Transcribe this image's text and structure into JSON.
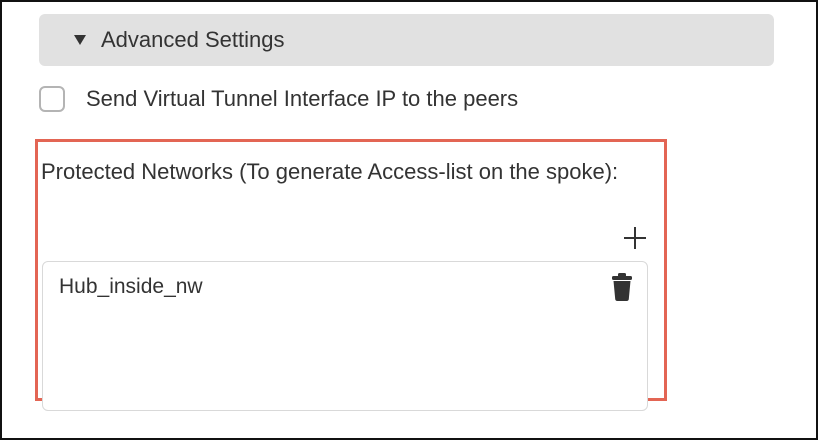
{
  "advanced_settings": {
    "title": "Advanced Settings",
    "expanded": true,
    "caret_icon": "caret-down-icon"
  },
  "vti_option": {
    "label": "Send Virtual Tunnel Interface IP to the peers",
    "checked": false
  },
  "protected_networks": {
    "label": "Protected Networks (To generate Access-list on the spoke):",
    "add_icon": "plus-icon",
    "items": [
      {
        "label": "Hub_inside_nw",
        "delete_icon": "trash-icon"
      }
    ]
  },
  "colors": {
    "highlight_border": "#e36554",
    "header_background": "#e1e1e1",
    "text": "#333333"
  }
}
